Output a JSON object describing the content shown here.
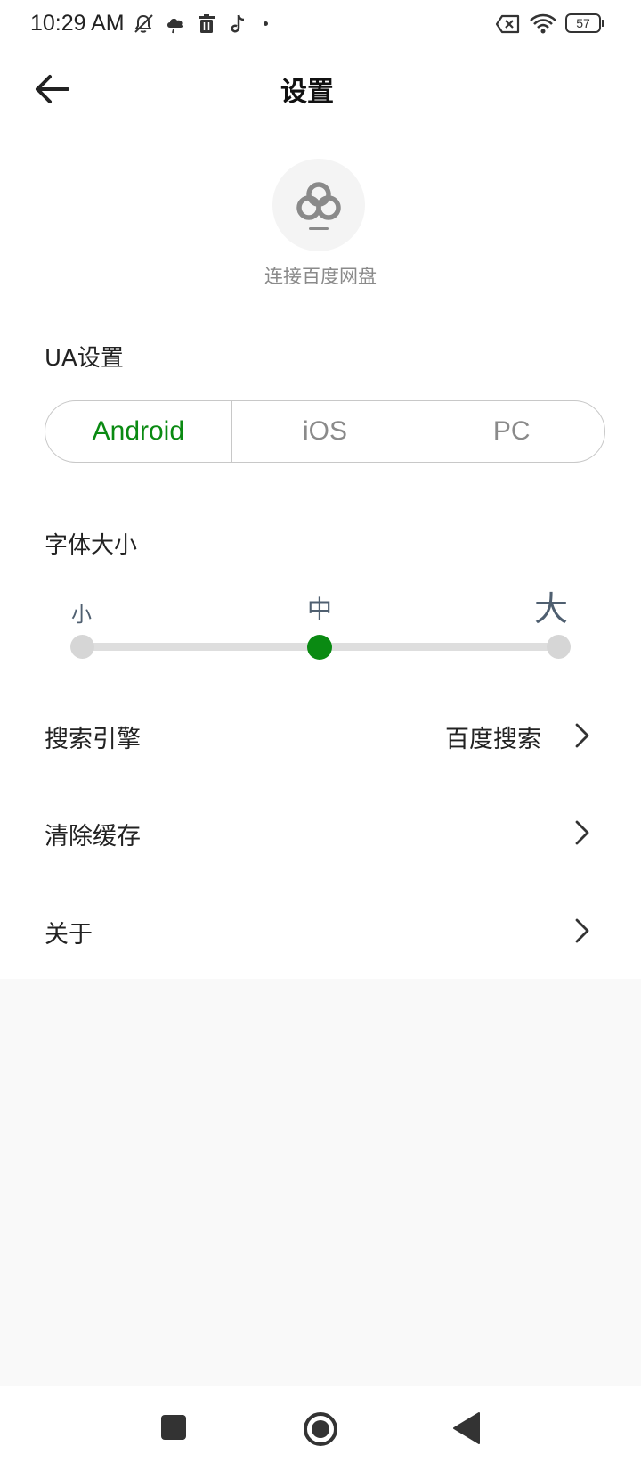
{
  "status_bar": {
    "time": "10:29 AM",
    "battery": "57",
    "icons": [
      "mute-icon",
      "weather-icon",
      "trash-icon",
      "tiktok-icon",
      "notification-dot-icon",
      "sim-off-icon",
      "wifi-icon",
      "battery-icon"
    ]
  },
  "header": {
    "title": "设置",
    "back_icon": "arrow-left-icon"
  },
  "baidu": {
    "icon": "baidu-cloud-icon",
    "label": "连接百度网盘"
  },
  "ua_settings": {
    "label": "UA设置",
    "options": [
      "Android",
      "iOS",
      "PC"
    ],
    "selected": "Android"
  },
  "font_size": {
    "label": "字体大小",
    "small": "小",
    "medium": "中",
    "large": "大",
    "selected": "中",
    "selected_index": 1,
    "steps": 3
  },
  "list": {
    "search_engine": {
      "label": "搜索引擎",
      "value": "百度搜索"
    },
    "clear_cache": {
      "label": "清除缓存"
    },
    "about": {
      "label": "关于"
    }
  },
  "nav_bar": {
    "icons": [
      "recents-square-icon",
      "home-circle-icon",
      "back-triangle-icon"
    ]
  },
  "colors": {
    "accent": "#0a8a12",
    "text": "#222222",
    "muted": "#8a8a8a",
    "size_label": "#4f5f70",
    "track": "#dedede",
    "background_empty": "#f9f9f9"
  }
}
